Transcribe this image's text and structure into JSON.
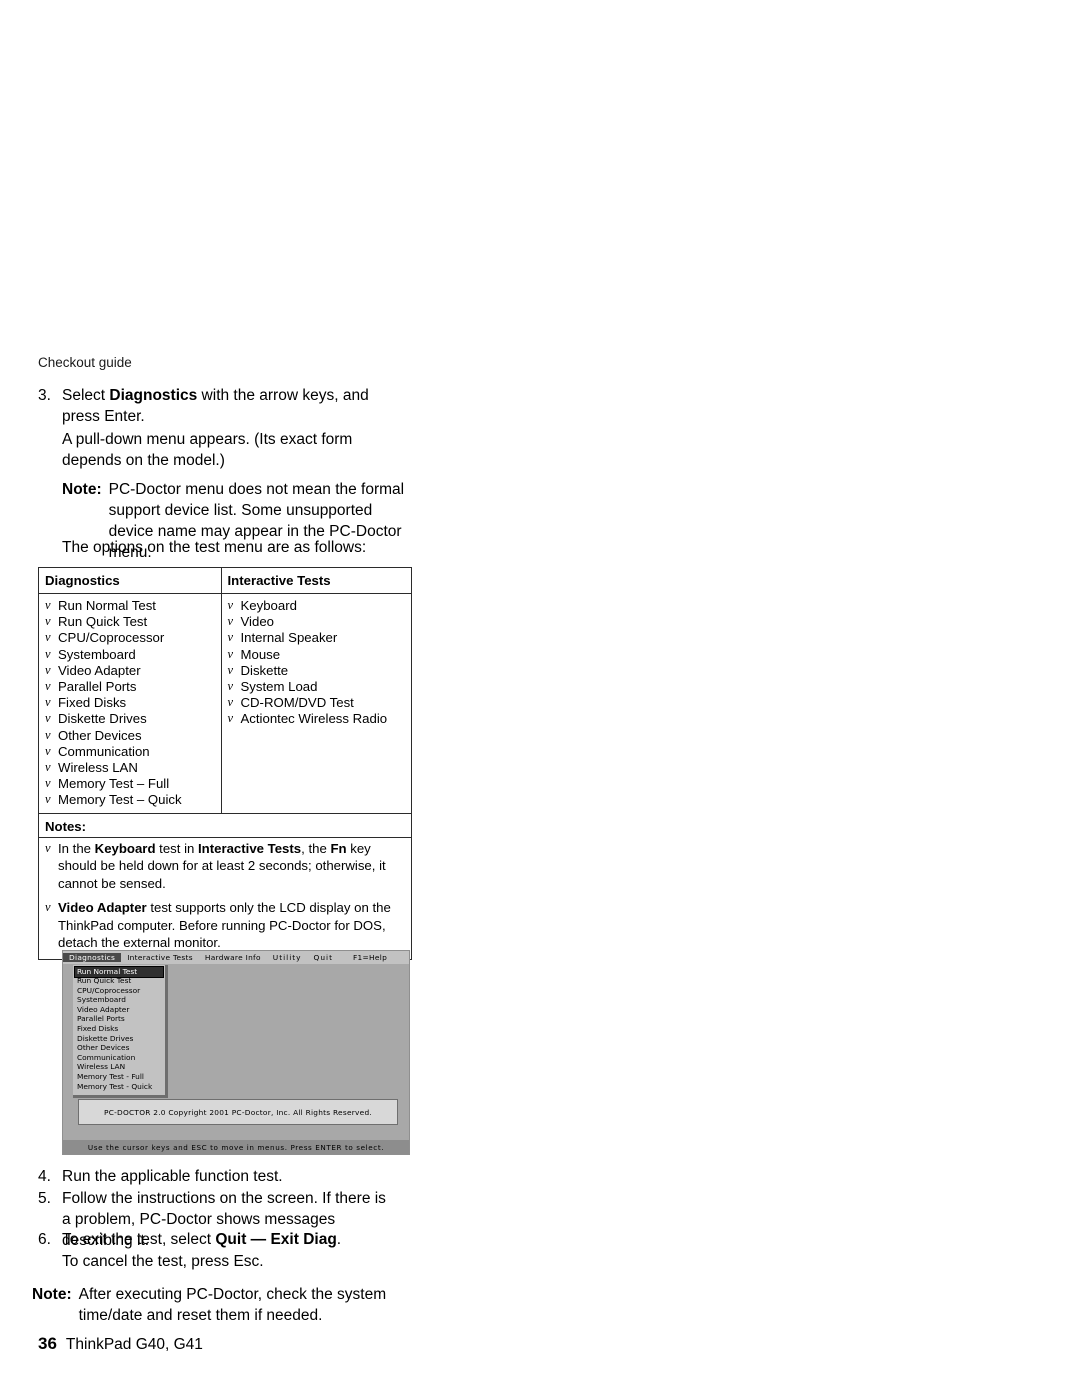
{
  "running_head": "Checkout guide",
  "steps": {
    "s3": {
      "num": "3.",
      "text_pre": "Select ",
      "text_bold": "Diagnostics",
      "text_post": " with the arrow keys, and press Enter."
    },
    "s3_para": "A pull-down menu appears. (Its exact form depends on the model.)",
    "note1": {
      "label": "Note:",
      "text": "PC-Doctor menu does not mean the formal support device list. Some unsupported device name may appear in the PC-Doctor menu."
    },
    "s3_para2": "The options on the test menu are as follows:",
    "s4": {
      "num": "4.",
      "text": "Run the applicable function test."
    },
    "s5": {
      "num": "5.",
      "text": "Follow the instructions on the screen. If there is a problem, PC-Doctor shows messages describing it."
    },
    "s6": {
      "num": "6.",
      "text_pre": "To exit the test, select ",
      "text_bold": "Quit — Exit Diag",
      "text_post": "."
    },
    "s6_para": "To cancel the test, press Esc.",
    "note2": {
      "label": "Note:",
      "text": "After executing PC-Doctor, check the system time/date and reset them if needed."
    }
  },
  "options_table": {
    "headers": [
      "Diagnostics",
      "Interactive Tests"
    ],
    "diagnostics": [
      "Run Normal Test",
      "Run Quick Test",
      "CPU/Coprocessor",
      "Systemboard",
      "Video Adapter",
      "Parallel Ports",
      "Fixed Disks",
      "Diskette Drives",
      "Other Devices",
      "Communication",
      "Wireless LAN",
      "Memory Test – Full",
      "Memory Test – Quick"
    ],
    "interactive_tests": [
      "Keyboard",
      "Video",
      "Internal Speaker",
      "Mouse",
      "Diskette",
      "System Load",
      "CD-ROM/DVD Test",
      "Actiontec Wireless Radio"
    ],
    "notes_header": "Notes:",
    "notes": [
      {
        "parts": [
          {
            "t": "In the ",
            "b": false
          },
          {
            "t": "Keyboard",
            "b": true
          },
          {
            "t": " test in ",
            "b": false
          },
          {
            "t": "Interactive Tests",
            "b": true
          },
          {
            "t": ", the ",
            "b": false
          },
          {
            "t": "Fn",
            "b": true
          },
          {
            "t": " key should be held down for at least 2 seconds; otherwise, it cannot be sensed.",
            "b": false
          }
        ]
      },
      {
        "parts": [
          {
            "t": "Video Adapter",
            "b": true
          },
          {
            "t": " test supports only the LCD display on the ThinkPad computer. Before running PC-Doctor for DOS, detach the external monitor.",
            "b": false
          }
        ]
      }
    ]
  },
  "pcdoctor": {
    "menubar": [
      {
        "label": "Diagnostics",
        "selected": true
      },
      {
        "label": "Interactive Tests",
        "selected": false
      },
      {
        "label": "Hardware Info",
        "selected": false
      },
      {
        "label": "Utility",
        "selected": false
      },
      {
        "label": "Quit",
        "selected": false
      },
      {
        "label": "F1=Help",
        "selected": false
      }
    ],
    "menu_items": [
      {
        "label": "Run Normal Test",
        "selected": true
      },
      {
        "label": "Run Quick Test",
        "selected": false
      },
      {
        "label": "CPU/Coprocessor",
        "selected": false
      },
      {
        "label": "Systemboard",
        "selected": false
      },
      {
        "label": "Video Adapter",
        "selected": false
      },
      {
        "label": "Parallel  Ports",
        "selected": false
      },
      {
        "label": "Fixed Disks",
        "selected": false
      },
      {
        "label": "Diskette Drives",
        "selected": false
      },
      {
        "label": "Other Devices",
        "selected": false
      },
      {
        "label": "Communication",
        "selected": false
      },
      {
        "label": "Wireless LAN",
        "selected": false
      },
      {
        "label": "Memory Test  -  Full",
        "selected": false
      },
      {
        "label": "Memory Test  -  Quick",
        "selected": false
      }
    ],
    "copyright": "PC-DOCTOR 2.0 Copyright 2001 PC-Doctor, Inc.  All Rights Reserved.",
    "status": "Use  the  cursor  keys  and  ESC  to  move  in  menus.   Press  ENTER  to  select."
  },
  "footer": {
    "page_number": "36",
    "book_title": "ThinkPad G40, G41"
  }
}
